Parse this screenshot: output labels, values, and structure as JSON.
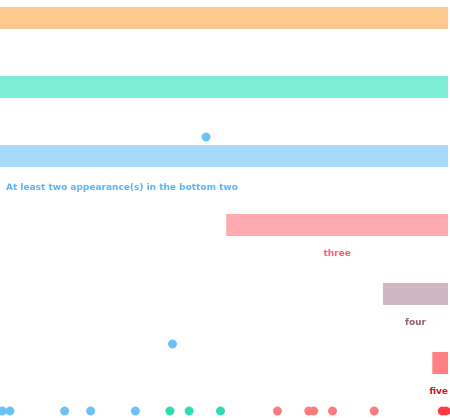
{
  "chart_data": {
    "type": "bar",
    "bars": [
      {
        "label": "",
        "start": 0,
        "end": 1.0,
        "color": "#FECA90"
      },
      {
        "label": "",
        "start": 0,
        "end": 1.0,
        "color": "#7EEDD6"
      },
      {
        "label": "",
        "start": 0,
        "end": 1.0,
        "color": "#A6D9FC"
      },
      {
        "label": "three",
        "start": 0.505,
        "end": 1.0,
        "color": "#FEAAB0",
        "label_color": "#FF5C66"
      },
      {
        "label": "four",
        "start": 0.855,
        "end": 1.0,
        "color": "#D1B6C2",
        "label_color": "#946079"
      },
      {
        "label": "five",
        "start": 0.965,
        "end": 1.0,
        "color": "#FF8083",
        "label_color": "#E01018"
      }
    ],
    "annotation": {
      "text": "At least two appearance(s) in the bottom two",
      "color": "#5BB4F5"
    },
    "annotation_points": [
      {
        "value": 0.46,
        "row": 2,
        "color": "#6CC1F6"
      },
      {
        "value": 0.385,
        "row": 5,
        "color": "#6CC1F6"
      }
    ],
    "axis_points": [
      {
        "value": 0.003,
        "color": "#6CC1F6"
      },
      {
        "value": 0.02,
        "color": "#6CC1F6"
      },
      {
        "value": 0.142,
        "color": "#6CC1F6"
      },
      {
        "value": 0.2,
        "color": "#6CC1F6"
      },
      {
        "value": 0.3,
        "color": "#6CC1F6"
      },
      {
        "value": 0.377,
        "color": "#2EDCB0"
      },
      {
        "value": 0.42,
        "color": "#2EDCB0"
      },
      {
        "value": 0.49,
        "color": "#2EDCB0"
      },
      {
        "value": 0.617,
        "color": "#FF7A7E"
      },
      {
        "value": 0.687,
        "color": "#FF7A7E"
      },
      {
        "value": 0.698,
        "color": "#FF7A7E"
      },
      {
        "value": 0.74,
        "color": "#FF7A7E"
      },
      {
        "value": 0.833,
        "color": "#FF7A7E"
      },
      {
        "value": 0.985,
        "color": "#FF3A44"
      },
      {
        "value": 0.995,
        "color": "#FF3A44"
      }
    ],
    "xlim": [
      0,
      1
    ],
    "grid": false,
    "legend": "none"
  }
}
